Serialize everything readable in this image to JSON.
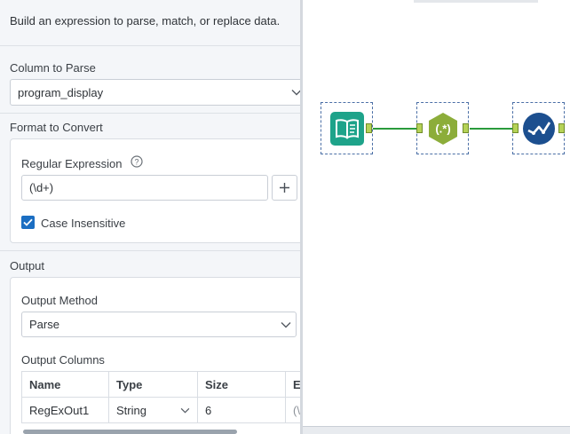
{
  "panel": {
    "intro": "Build an expression to parse, match, or replace data.",
    "column_to_parse": {
      "title": "Column to Parse",
      "value": "program_display"
    },
    "format_to_convert": {
      "title": "Format to Convert",
      "regex_label": "Regular Expression",
      "regex_value": "(\\d+)",
      "case_insensitive_label": "Case Insensitive",
      "case_insensitive_checked": true
    },
    "output": {
      "title": "Output",
      "method_label": "Output Method",
      "method_value": "Parse",
      "columns_label": "Output Columns",
      "columns": {
        "headers": [
          "Name",
          "Type",
          "Size",
          "E"
        ],
        "rows": [
          {
            "name": "RegExOut1",
            "type": "String",
            "size": "6",
            "extra": "(\\"
          }
        ]
      }
    }
  },
  "canvas": {
    "tools": [
      {
        "name": "input-data-tool",
        "icon": "book-icon",
        "color": "#1ea38a"
      },
      {
        "name": "regex-tool",
        "icon": "regex-icon",
        "color": "#8cad3a"
      },
      {
        "name": "browse-tool",
        "icon": "checkmark-wave-icon",
        "color": "#1c4f8f"
      }
    ]
  }
}
